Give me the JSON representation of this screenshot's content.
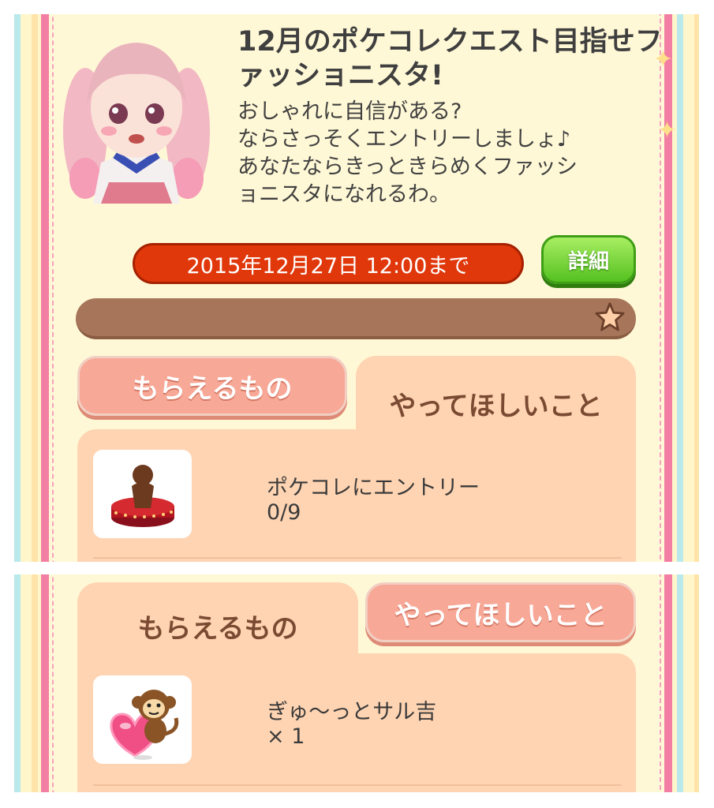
{
  "quest": {
    "title": "12月のポケコレクエスト目指せファッショニスタ!",
    "description_lines": [
      "おしゃれに自信がある?",
      "ならさっそくエントリーしましょ♪",
      "あなたならきっときらめくファッシ",
      "ョニスタになれるわ。"
    ],
    "deadline": "2015年12月27日 12:00まで",
    "detail_button": "詳細",
    "progress": 0
  },
  "tabs": {
    "rewards": "もらえるもの",
    "tasks": "やってほしいこと"
  },
  "task_item": {
    "name": "ポケコレにエントリー",
    "count": "0/9",
    "icon": "fashion-stage-icon"
  },
  "reward_item": {
    "name": "ぎゅ〜っとサル吉",
    "count": "× 1",
    "icon": "monkey-heart-icon"
  },
  "colors": {
    "frame_pink": "#f37ea3",
    "deadline_red": "#e0380b",
    "detail_green": "#55c120",
    "progress_brown": "#a7765a",
    "tab_salmon": "#f7a896",
    "content_peach": "#ffd4b2"
  }
}
